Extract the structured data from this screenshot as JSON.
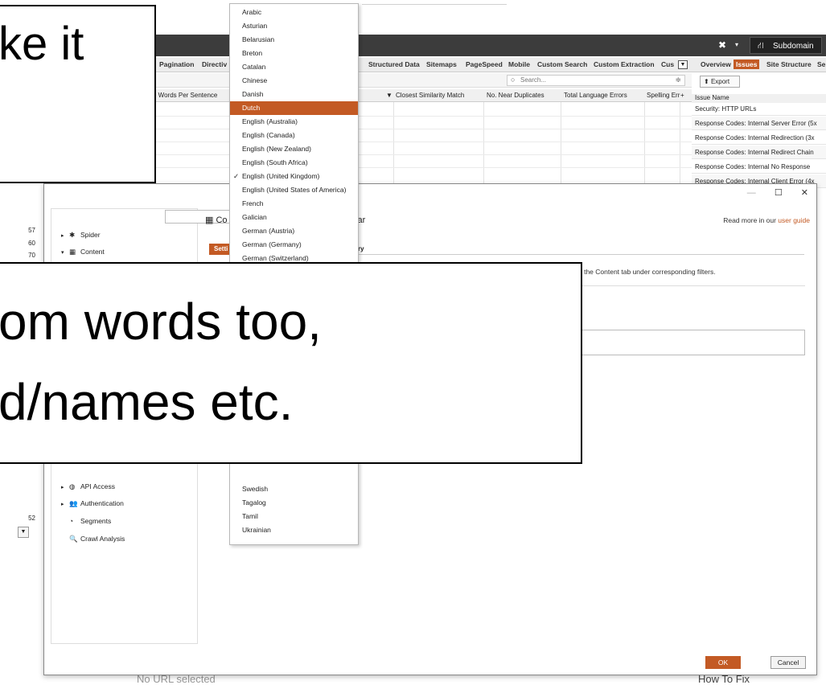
{
  "titlebar": {
    "close_icon": "close-icon",
    "mode_button": "Subdomain"
  },
  "tabs": [
    "Pagination",
    "Directiv",
    "Structured Data",
    "Sitemaps",
    "PageSpeed",
    "Mobile",
    "Custom Search",
    "Custom Extraction",
    "Cus"
  ],
  "right_tabs": [
    "Overview",
    "Issues",
    "Site Structure",
    "Se"
  ],
  "search": {
    "placeholder": "Search..."
  },
  "grid": {
    "columns": [
      "e Words Per Sentence",
      "Closest Similarity Match",
      "No. Near Duplicates",
      "Total Language Errors",
      "Spelling Err"
    ]
  },
  "right_pane": {
    "export_label": "Export",
    "issue_header": "Issue Name",
    "issues": [
      "Security: HTTP URLs",
      "Response Codes: Internal Server Error (5x",
      "Response Codes: Internal Redirection (3x",
      "Response Codes: Internal Redirect Chain",
      "Response Codes: Internal No Response",
      "Response Codes: Internal Client Error (4x"
    ]
  },
  "left_numbers": [
    "57",
    "60",
    "70",
    "52"
  ],
  "dialog": {
    "title_partial": "Co",
    "title_suffix": "ar",
    "read_more_prefix": "Read more in our",
    "read_more_link": "user guide",
    "subtab_settings": "Setti",
    "subtab_other": "ry",
    "info_text": "n the Content tab under corresponding filters.",
    "ok_label": "OK",
    "cancel_label": "Cancel",
    "tree": [
      {
        "label": "Spider",
        "icon": "gear-icon",
        "glyph": "✱",
        "expander": "▸"
      },
      {
        "label": "Content",
        "icon": "table-icon",
        "glyph": "▦",
        "expander": "▾"
      },
      {
        "label": "API Access",
        "icon": "globe-icon",
        "glyph": "◍",
        "expander": "▸"
      },
      {
        "label": "Authentication",
        "icon": "users-icon",
        "glyph": "👥",
        "expander": "▸"
      },
      {
        "label": "Segments",
        "icon": "pie-icon",
        "glyph": "◔",
        "expander": ""
      },
      {
        "label": "Crawl Analysis",
        "icon": "search-icon",
        "glyph": "🔍",
        "expander": ""
      }
    ]
  },
  "dropdown": {
    "selected": "Dutch",
    "checked": "English (United Kingdom)",
    "languages": [
      "Arabic",
      "Asturian",
      "Belarusian",
      "Breton",
      "Catalan",
      "Chinese",
      "Danish",
      "Dutch",
      "English (Australia)",
      "English (Canada)",
      "English (New Zealand)",
      "English (South Africa)",
      "English (United Kingdom)",
      "English (United States of America)",
      "French",
      "Galician",
      "German (Austria)",
      "German (Germany)",
      "German (Switzerland)"
    ],
    "languages_tail": [
      "Swedish",
      "Tagalog",
      "Tamil",
      "Ukrainian"
    ]
  },
  "footer": {
    "no_url": "No URL selected",
    "how_to_fix": "How To Fix"
  },
  "callouts": {
    "top": "ke it",
    "bottom_line1": "om words too,",
    "bottom_line2": "d/names etc."
  },
  "colors": {
    "accent": "#c35a24",
    "titlebar": "#3c3c3c"
  }
}
